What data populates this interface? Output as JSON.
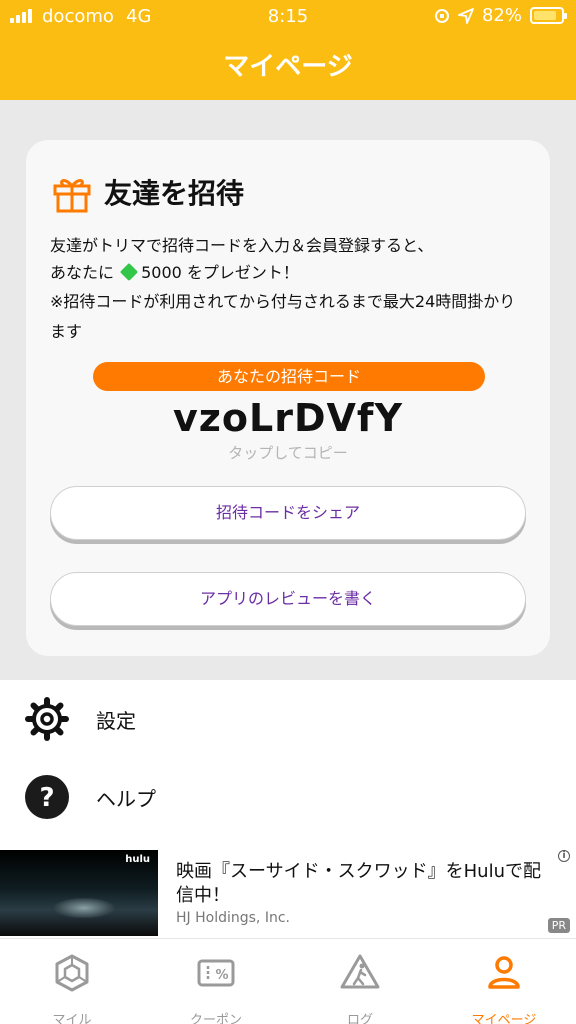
{
  "status_bar": {
    "carrier": "docomo",
    "network": "4G",
    "time": "8:15",
    "battery": "82%"
  },
  "header": {
    "title": "マイページ"
  },
  "invite_card": {
    "title": "友達を招待",
    "desc_line1": "友達がトリマで招待コードを入力＆会員登録すると、",
    "desc_line2_prefix": "あなたに",
    "desc_line2_amount": "5000",
    "desc_line2_suffix": "をプレゼント！",
    "note": "※招待コードが利用されてから付与されるまで最大24時間掛かります",
    "code_label": "あなたの招待コード",
    "code": "vzoLrDVfY",
    "tap_copy": "タップしてコピー",
    "share_button": "招待コードをシェア",
    "review_button": "アプリのレビューを書く"
  },
  "menu": {
    "settings": "設定",
    "help": "ヘルプ"
  },
  "ad": {
    "image_brand": "hulu",
    "title": "映画『スーサイド・スクワッド』をHuluで配信中！",
    "advertiser": "HJ Holdings, Inc.",
    "pr_label": "PR",
    "info_icon": "i"
  },
  "tabs": [
    {
      "label": "マイル",
      "icon": "gem-outline-icon"
    },
    {
      "label": "クーポン",
      "icon": "coupon-icon"
    },
    {
      "label": "ログ",
      "icon": "walker-icon"
    },
    {
      "label": "マイページ",
      "icon": "person-icon"
    }
  ],
  "colors": {
    "header": "#fcbd13",
    "accent": "#ff7a00",
    "button_text": "#6b2ea3"
  }
}
